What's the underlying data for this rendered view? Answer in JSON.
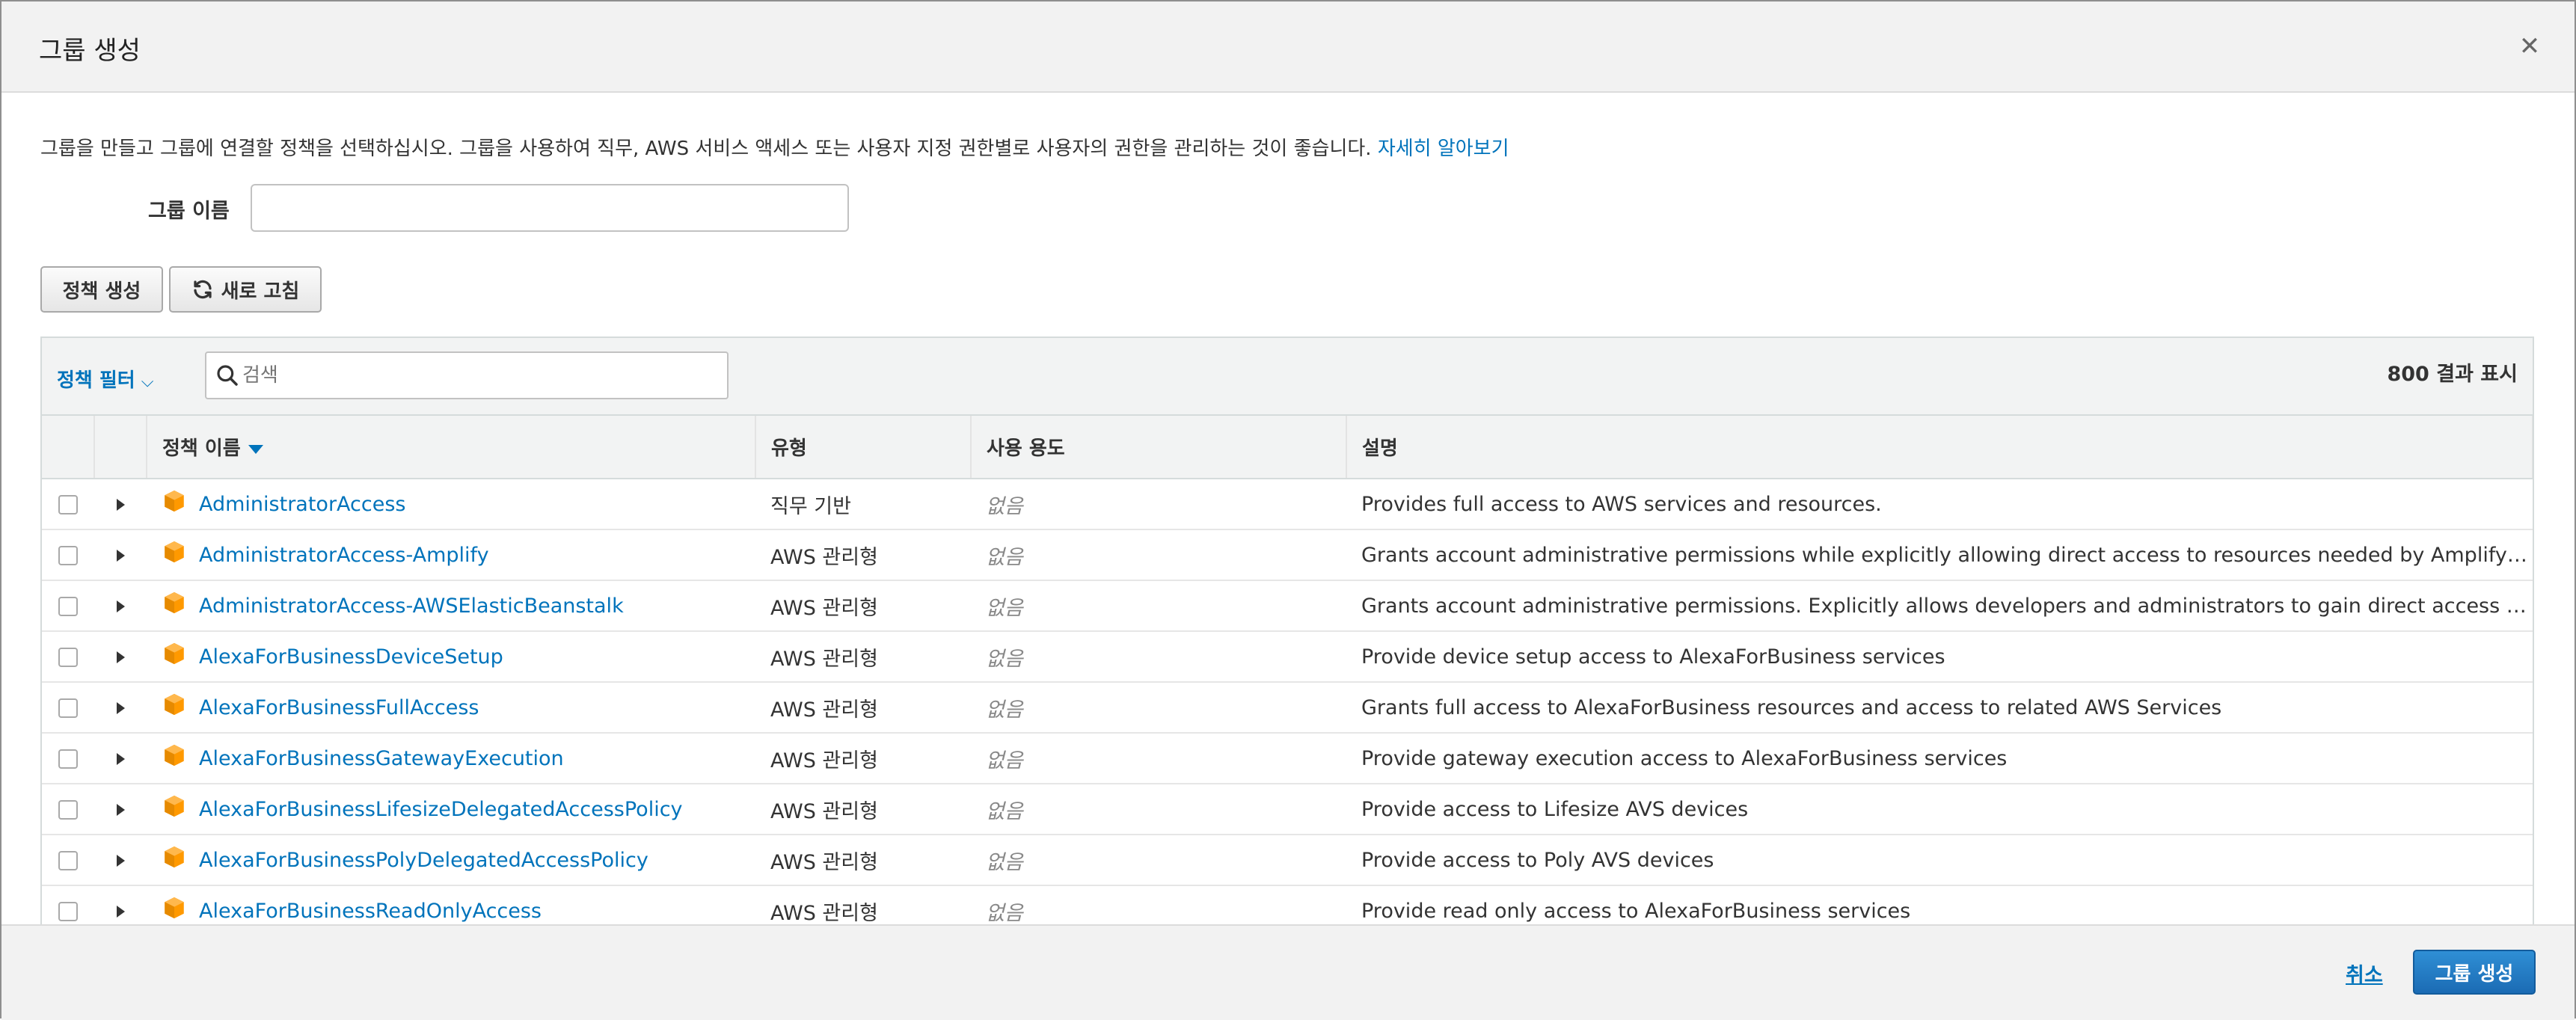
{
  "dialog": {
    "title": "그룹 생성",
    "close_icon": "close-icon"
  },
  "intro": {
    "text": "그룹을 만들고 그룹에 연결할 정책을 선택하십시오. 그룹을 사용하여 직무, AWS 서비스 액세스 또는 사용자 지정 권한별로 사용자의 권한을 관리하는 것이 좋습니다. ",
    "link": "자세히 알아보기"
  },
  "group_name": {
    "label": "그룹 이름",
    "value": ""
  },
  "toolbar": {
    "create_policy_label": "정책 생성",
    "refresh_label": "새로 고침",
    "refresh_icon": "refresh-icon"
  },
  "filter": {
    "label": "정책 필터",
    "search_placeholder": "검색",
    "result_count": "800 결과 표시"
  },
  "columns": {
    "name": "정책 이름",
    "type": "유형",
    "usage": "사용 용도",
    "description": "설명"
  },
  "rows": [
    {
      "name": "AdministratorAccess",
      "type": "직무 기반",
      "usage": "없음",
      "description": "Provides full access to AWS services and resources."
    },
    {
      "name": "AdministratorAccess-Amplify",
      "type": "AWS 관리형",
      "usage": "없음",
      "description": "Grants account administrative permissions while explicitly allowing direct access to resources needed by Amplify applicat…"
    },
    {
      "name": "AdministratorAccess-AWSElasticBeanstalk",
      "type": "AWS 관리형",
      "usage": "없음",
      "description": "Grants account administrative permissions. Explicitly allows developers and administrators to gain direct access to resour…"
    },
    {
      "name": "AlexaForBusinessDeviceSetup",
      "type": "AWS 관리형",
      "usage": "없음",
      "description": "Provide device setup access to AlexaForBusiness services"
    },
    {
      "name": "AlexaForBusinessFullAccess",
      "type": "AWS 관리형",
      "usage": "없음",
      "description": "Grants full access to AlexaForBusiness resources and access to related AWS Services"
    },
    {
      "name": "AlexaForBusinessGatewayExecution",
      "type": "AWS 관리형",
      "usage": "없음",
      "description": "Provide gateway execution access to AlexaForBusiness services"
    },
    {
      "name": "AlexaForBusinessLifesizeDelegatedAccessPolicy",
      "type": "AWS 관리형",
      "usage": "없음",
      "description": "Provide access to Lifesize AVS devices"
    },
    {
      "name": "AlexaForBusinessPolyDelegatedAccessPolicy",
      "type": "AWS 관리형",
      "usage": "없음",
      "description": "Provide access to Poly AVS devices"
    },
    {
      "name": "AlexaForBusinessReadOnlyAccess",
      "type": "AWS 관리형",
      "usage": "없음",
      "description": "Provide read only access to AlexaForBusiness services"
    }
  ],
  "footer": {
    "cancel_label": "취소",
    "create_group_label": "그룹 생성"
  },
  "colors": {
    "link": "#0073bb",
    "primary_button": "#1b6bb4",
    "policy_icon": "#f90"
  }
}
